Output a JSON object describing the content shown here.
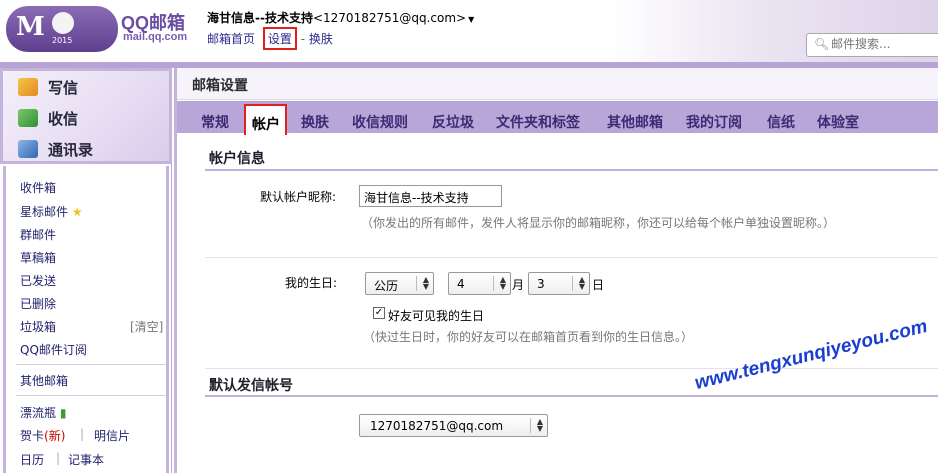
{
  "brand": {
    "name": "QQ邮箱",
    "url": "mail.qq.com",
    "year": "2015"
  },
  "account": {
    "name": "海甘信息--技术支持",
    "email": "<1270182751@qq.com>"
  },
  "nav": {
    "home": "邮箱首页",
    "sep1": "|",
    "settings": "设置",
    "sep2": "-",
    "skin": "换肤"
  },
  "search": {
    "placeholder": "邮件搜索..."
  },
  "sidebar": {
    "compose": "写信",
    "receive": "收信",
    "contacts": "通讯录",
    "folders": {
      "inbox": "收件箱",
      "starred": "星标邮件",
      "group": "群邮件",
      "drafts": "草稿箱",
      "sent": "已发送",
      "deleted": "已删除",
      "spam": "垃圾箱",
      "spam_clear": "[清空]",
      "subscription": "QQ邮件订阅",
      "other": "其他邮箱",
      "drift": "漂流瓶",
      "card": "贺卡",
      "card_new": "(新)",
      "postcard": "明信片",
      "calendar": "日历",
      "notes": "记事本",
      "pipe": "|"
    }
  },
  "main": {
    "title": "邮箱设置",
    "tabs": [
      "常规",
      "帐户",
      "换肤",
      "收信规则",
      "反垃圾",
      "文件夹和标签",
      "其他邮箱",
      "我的订阅",
      "信纸",
      "体验室"
    ],
    "account_info": {
      "heading": "帐户信息",
      "nick_label": "默认帐户昵称:",
      "nick_value": "海甘信息--技术支持",
      "nick_hint": "（你发出的所有邮件，发件人将显示你的邮箱昵称，你还可以给每个帐户单独设置昵称。）",
      "birthday_label": "我的生日:",
      "calendar_type": "公历",
      "month": "4",
      "month_unit": "月",
      "day": "3",
      "day_unit": "日",
      "friends_check": "好友可见我的生日",
      "birthday_hint": "（快过生日时，你的好友可以在邮箱首页看到你的生日信息。）"
    },
    "default_sender": {
      "heading": "默认发信帐号",
      "value": "1270182751@qq.com"
    }
  },
  "watermark": "www.tengxunqiyeyou.com",
  "colors": {
    "accent": "#6b4ea1",
    "tab_bar": "#b9a6d9",
    "highlight": "#e02020"
  }
}
